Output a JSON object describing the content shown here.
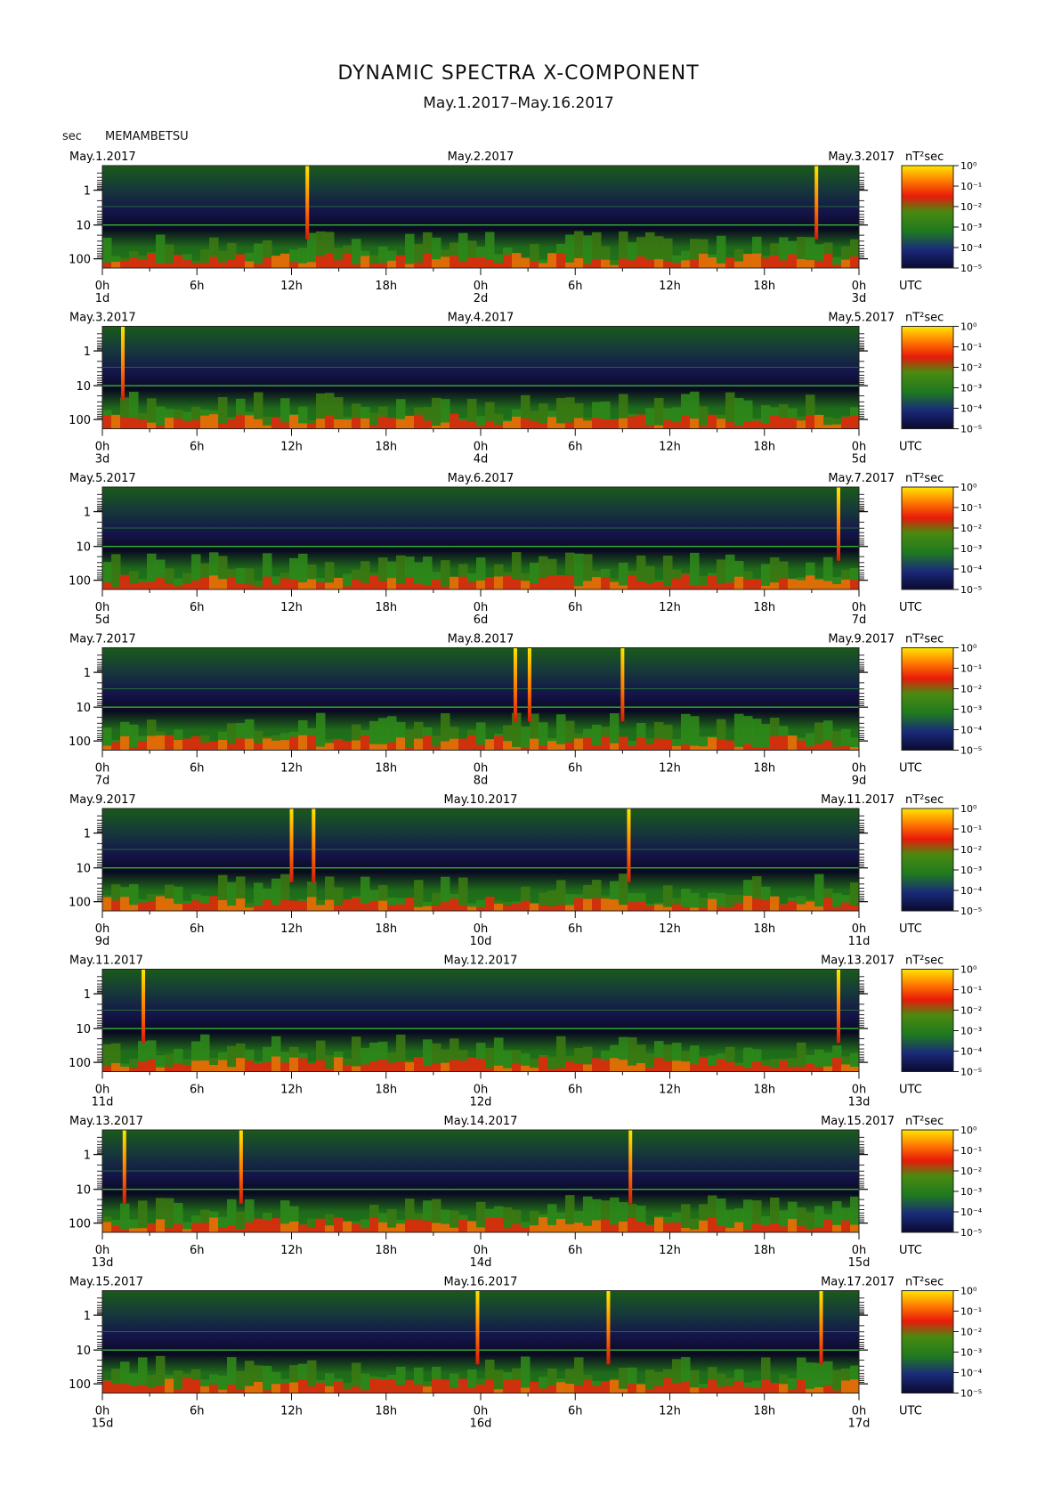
{
  "title": "DYNAMIC SPECTRA X-COMPONENT",
  "subtitle": "May.1.2017–May.16.2017",
  "station": "MEMAMBETSU",
  "period_unit": "sec",
  "colorbar_unit": "nT²sec",
  "time_zone": "UTC",
  "colors": {
    "low": "#10103a",
    "mid": "#1f7a1f",
    "high": "#e81a0a",
    "peak": "#ffe600"
  },
  "chart_data": {
    "type": "heatmap",
    "x_ticks": [
      "0h",
      "6h",
      "12h",
      "18h",
      "0h",
      "6h",
      "12h",
      "18h",
      "0h"
    ],
    "y_axis": {
      "label": "sec",
      "ticks": [
        "1",
        "10",
        "100"
      ],
      "scale": "log"
    },
    "colorbar": {
      "label": "nT²sec",
      "ticks": [
        "10⁰",
        "10⁻¹",
        "10⁻²",
        "10⁻³",
        "10⁻⁴",
        "10⁻⁵"
      ],
      "scale": "log"
    },
    "panels": [
      {
        "date_left": "May.1.2017",
        "date_mid": "May.2.2017",
        "date_right": "May.3.2017",
        "days": [
          "1d",
          "2d",
          "3d"
        ],
        "events_hours": [
          13,
          45.3
        ]
      },
      {
        "date_left": "May.3.2017",
        "date_mid": "May.4.2017",
        "date_right": "May.5.2017",
        "days": [
          "3d",
          "4d",
          "5d"
        ],
        "events_hours": [
          1.3
        ]
      },
      {
        "date_left": "May.5.2017",
        "date_mid": "May.6.2017",
        "date_right": "May.7.2017",
        "days": [
          "5d",
          "6d",
          "7d"
        ],
        "events_hours": [
          46.7
        ]
      },
      {
        "date_left": "May.7.2017",
        "date_mid": "May.8.2017",
        "date_right": "May.9.2017",
        "days": [
          "7d",
          "8d",
          "9d"
        ],
        "events_hours": [
          26.2,
          27.1,
          33
        ]
      },
      {
        "date_left": "May.9.2017",
        "date_mid": "May.10.2017",
        "date_right": "May.11.2017",
        "days": [
          "9d",
          "10d",
          "11d"
        ],
        "events_hours": [
          12,
          13.4,
          33.4
        ]
      },
      {
        "date_left": "May.11.2017",
        "date_mid": "May.12.2017",
        "date_right": "May.13.2017",
        "days": [
          "11d",
          "12d",
          "13d"
        ],
        "events_hours": [
          2.6,
          46.7
        ]
      },
      {
        "date_left": "May.13.2017",
        "date_mid": "May.14.2017",
        "date_right": "May.15.2017",
        "days": [
          "13d",
          "14d",
          "15d"
        ],
        "events_hours": [
          1.4,
          8.8,
          33.5
        ]
      },
      {
        "date_left": "May.15.2017",
        "date_mid": "May.16.2017",
        "date_right": "May.17.2017",
        "days": [
          "15d",
          "16d",
          "17d"
        ],
        "events_hours": [
          23.8,
          32.1,
          45.6
        ]
      }
    ]
  }
}
